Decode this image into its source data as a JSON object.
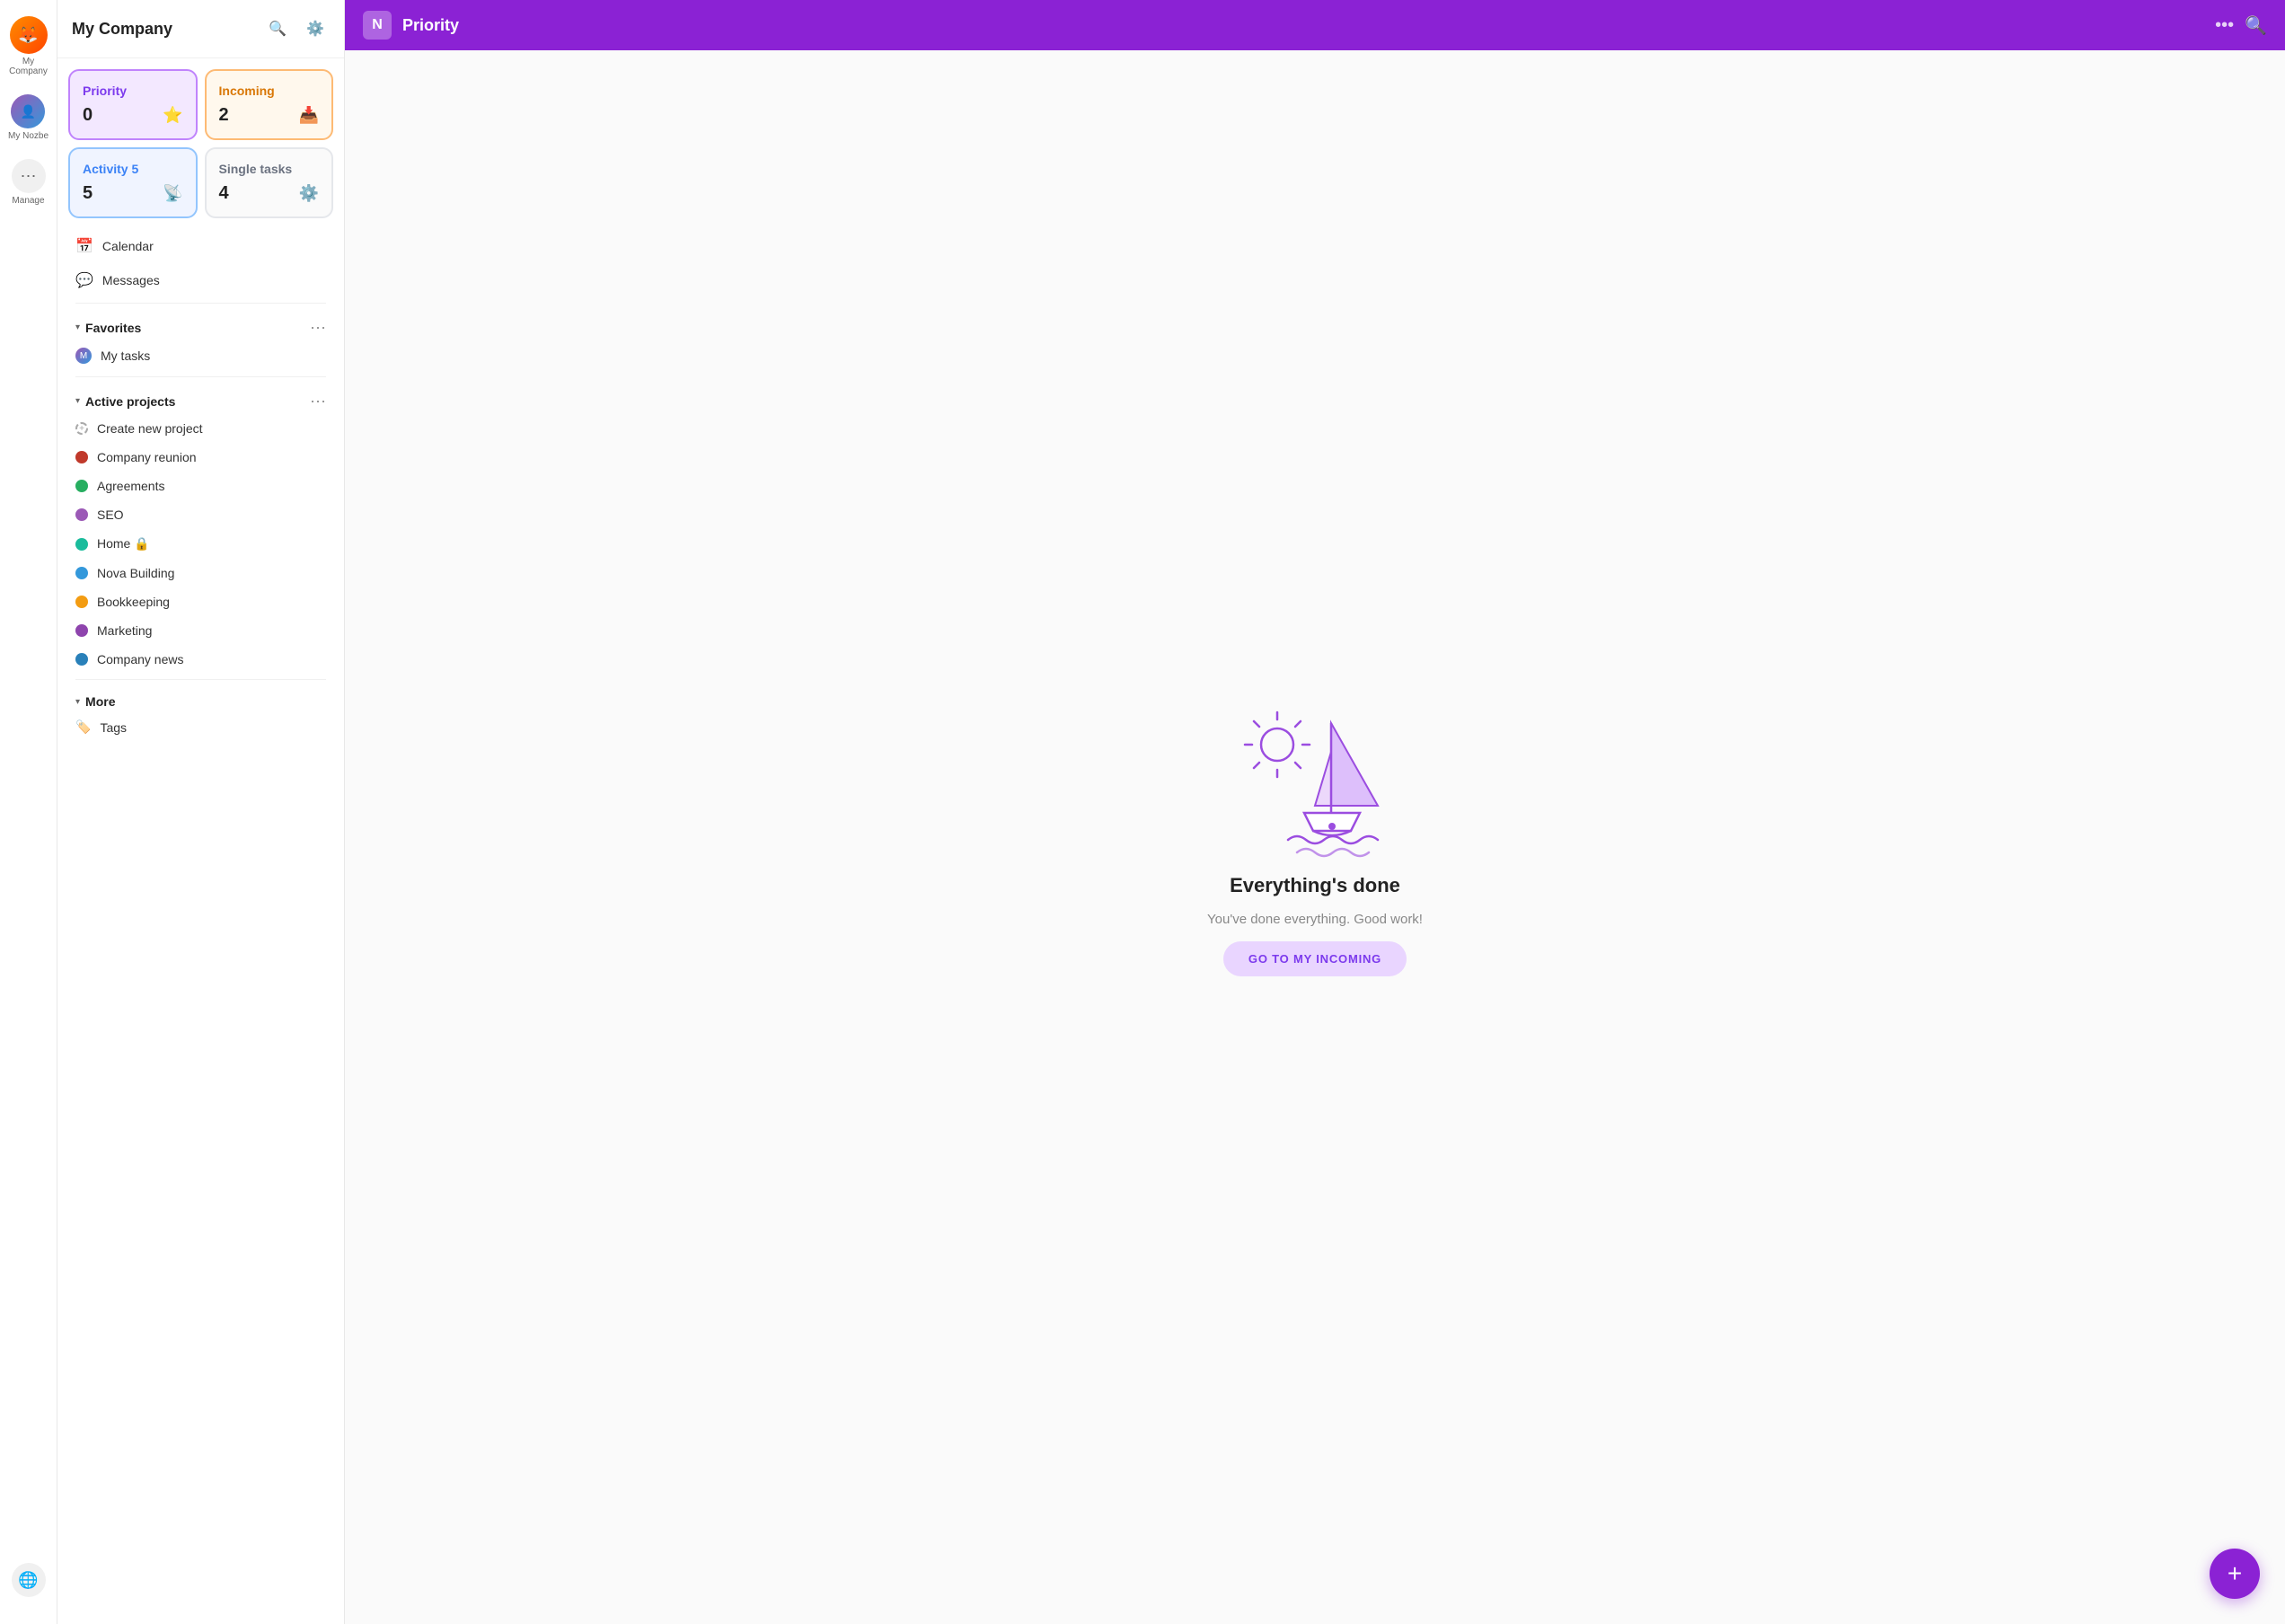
{
  "iconBar": {
    "companyName": "My Company",
    "myNozbeLabel": "My Nozbe",
    "manageLabel": "Manage"
  },
  "sidebar": {
    "title": "My Company",
    "tiles": [
      {
        "id": "priority",
        "label": "Priority",
        "count": "0",
        "iconSymbol": "⭐",
        "type": "priority"
      },
      {
        "id": "incoming",
        "label": "Incoming",
        "count": "2",
        "iconSymbol": "📥",
        "type": "incoming"
      },
      {
        "id": "activity",
        "label": "Activity 5",
        "count": "5",
        "iconSymbol": "📡",
        "type": "activity"
      },
      {
        "id": "single",
        "label": "Single tasks",
        "count": "4",
        "iconSymbol": "⚙️",
        "type": "single"
      }
    ],
    "navItems": [
      {
        "id": "calendar",
        "label": "Calendar",
        "icon": "📅"
      },
      {
        "id": "messages",
        "label": "Messages",
        "icon": "💬"
      }
    ],
    "favorites": {
      "label": "Favorites",
      "items": [
        {
          "id": "my-tasks",
          "label": "My tasks",
          "avatarText": "M"
        }
      ]
    },
    "activeProjects": {
      "label": "Active projects",
      "createLabel": "Create new project",
      "items": [
        {
          "id": "company-reunion",
          "label": "Company reunion",
          "color": "#c0392b"
        },
        {
          "id": "agreements",
          "label": "Agreements",
          "color": "#27ae60"
        },
        {
          "id": "seo",
          "label": "SEO",
          "color": "#9b59b6"
        },
        {
          "id": "home",
          "label": "Home 🔒",
          "color": "#1abc9c"
        },
        {
          "id": "nova-building",
          "label": "Nova Building",
          "color": "#3498db"
        },
        {
          "id": "bookkeeping",
          "label": "Bookkeeping",
          "color": "#f39c12"
        },
        {
          "id": "marketing",
          "label": "Marketing",
          "color": "#8e44ad"
        },
        {
          "id": "company-news",
          "label": "Company news",
          "color": "#2980b9"
        }
      ]
    },
    "more": {
      "label": "More",
      "items": [
        {
          "id": "tags",
          "label": "Tags",
          "icon": "🏷️"
        }
      ]
    }
  },
  "topbar": {
    "logoText": "N",
    "title": "Priority",
    "dotsLabel": "•••",
    "searchIcon": "search"
  },
  "emptyState": {
    "title": "Everything's done",
    "subtitle": "You've done everything. Good work!",
    "buttonLabel": "GO TO MY INCOMING"
  },
  "fab": {
    "label": "+"
  }
}
